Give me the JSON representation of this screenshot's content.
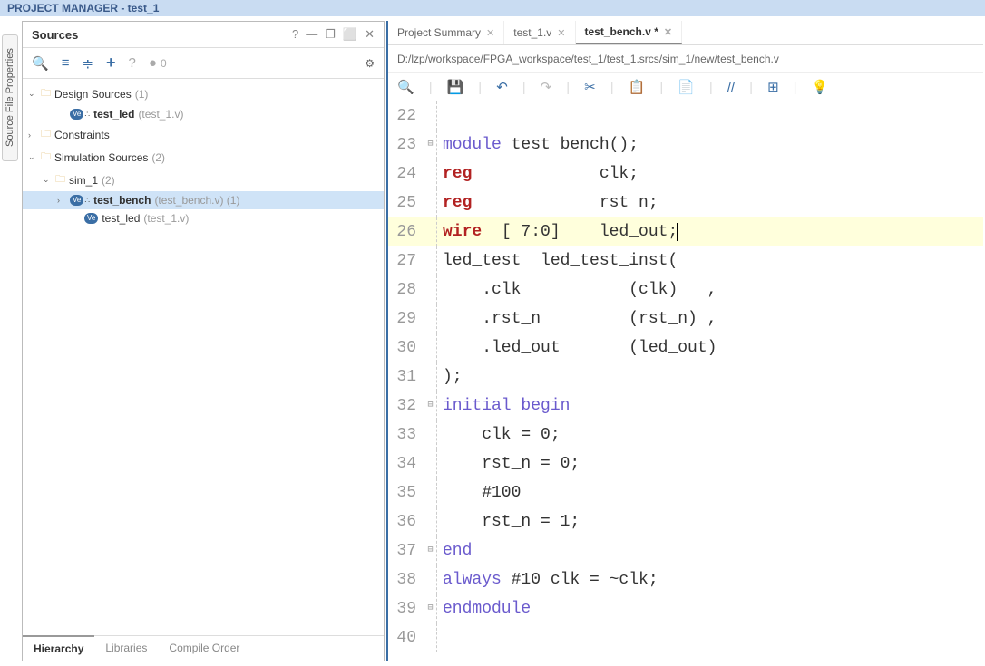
{
  "title_bar": "PROJECT MANAGER - test_1",
  "side_tab": "Source File Properties",
  "sources": {
    "title": "Sources",
    "ctrl_help": "?",
    "ctrl_min": "—",
    "ctrl_rest": "❐",
    "ctrl_max": "⬜",
    "ctrl_close": "✕",
    "tb_search": "🔍",
    "tb_collapse": "≡",
    "tb_expand": "≑",
    "tb_plus": "+",
    "tb_info": "?",
    "tb_count": "0",
    "tb_gear": "⚙",
    "tree": {
      "design_sources": "Design Sources",
      "design_sources_count": "(1)",
      "test_led": "test_led",
      "test_led_file": "(test_1.v)",
      "constraints": "Constraints",
      "sim_sources": "Simulation Sources",
      "sim_sources_count": "(2)",
      "sim_1": "sim_1",
      "sim_1_count": "(2)",
      "test_bench": "test_bench",
      "test_bench_file": "(test_bench.v) (1)",
      "test_led2": "test_led",
      "test_led2_file": "(test_1.v)"
    },
    "tabs": {
      "hierarchy": "Hierarchy",
      "libraries": "Libraries",
      "compile_order": "Compile Order"
    }
  },
  "editor": {
    "tabs": {
      "summary": "Project Summary",
      "t1": "test_1.v",
      "tb": "test_bench.v *"
    },
    "path": "D:/lzp/workspace/FPGA_workspace/test_1/test_1.srcs/sim_1/new/test_bench.v",
    "tb_search": "🔍",
    "tb_save": "💾",
    "tb_undo": "↶",
    "tb_redo": "↷",
    "tb_cut": "✂",
    "tb_copy": "📋",
    "tb_paste": "📄",
    "tb_comment": "//",
    "tb_tab": "⊞",
    "tb_bulb": "💡",
    "lines": [
      {
        "n": "22",
        "f": "",
        "t": ""
      },
      {
        "n": "23",
        "f": "⊟",
        "t": "module test_bench();",
        "cls": "mod"
      },
      {
        "n": "24",
        "f": "",
        "t": "reg             clk;",
        "cls": "reg"
      },
      {
        "n": "25",
        "f": "",
        "t": "reg             rst_n;",
        "cls": "reg"
      },
      {
        "n": "26",
        "f": "",
        "t": "wire  [ 7:0]    led_out;",
        "cls": "wire",
        "hl": true
      },
      {
        "n": "27",
        "f": "",
        "t": "led_test  led_test_inst("
      },
      {
        "n": "28",
        "f": "",
        "t": "    .clk           (clk)   ,"
      },
      {
        "n": "29",
        "f": "",
        "t": "    .rst_n         (rst_n) ,"
      },
      {
        "n": "30",
        "f": "",
        "t": "    .led_out       (led_out)"
      },
      {
        "n": "31",
        "f": "",
        "t": ");"
      },
      {
        "n": "32",
        "f": "⊟",
        "t": "initial begin",
        "cls": "init"
      },
      {
        "n": "33",
        "f": "",
        "t": "    clk = 0;"
      },
      {
        "n": "34",
        "f": "",
        "t": "    rst_n = 0;"
      },
      {
        "n": "35",
        "f": "",
        "t": "    #100"
      },
      {
        "n": "36",
        "f": "",
        "t": "    rst_n = 1;"
      },
      {
        "n": "37",
        "f": "⊟",
        "t": "end",
        "cls": "init"
      },
      {
        "n": "38",
        "f": "",
        "t": "always #10 clk = ~clk;",
        "cls": "alw"
      },
      {
        "n": "39",
        "f": "⊟",
        "t": "endmodule",
        "cls": "mod"
      },
      {
        "n": "40",
        "f": "",
        "t": ""
      }
    ]
  }
}
